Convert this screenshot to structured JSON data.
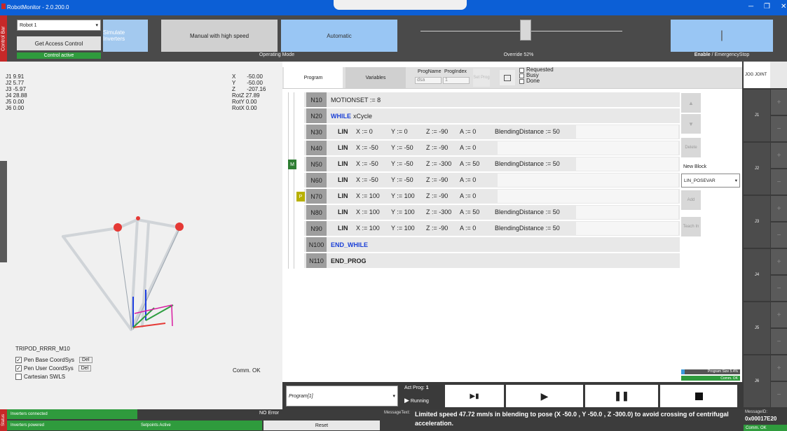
{
  "window": {
    "title": "RobotMonitor - 2.0.200.0",
    "minimize": "─",
    "restore": "❐",
    "close": "✕"
  },
  "control_bar": {
    "side_label": "Control Bar",
    "robot_select": "Robot 1",
    "get_access": "Get Access Control",
    "control_active": "Control active",
    "simulate_inverters": "Simulate Inverters",
    "manual_high_speed": "Manual with high speed",
    "automatic": "Automatic",
    "operating_mode_label": "Operating Mode",
    "override_label": "Override 52%",
    "override_percent": 52,
    "enable_label": "Enable",
    "estop_label": " / EmergencyStop",
    "enable_glyph": "|"
  },
  "joints": [
    "J1 9.91",
    "J2 5.77",
    "J3 -5.97",
    "J4 28.88",
    "J5 0.00",
    "J6 0.00"
  ],
  "cartesian": [
    {
      "axis": "X",
      "value": "-50.00"
    },
    {
      "axis": "Y",
      "value": "-50.00"
    },
    {
      "axis": "Z",
      "value": "-207.16"
    },
    {
      "axis": "RotZ",
      "value": "27.89"
    },
    {
      "axis": "RotY",
      "value": "0.00"
    },
    {
      "axis": "RotX",
      "value": "0.00"
    }
  ],
  "robot_name": "TRIPOD_RRRR_M10",
  "pen_base": "Pen Base CoordSys",
  "pen_user": "Pen User CoordSys",
  "cartesian_swls": "Cartesian SWLS",
  "del": "Del",
  "check": "✓",
  "comm_ok": "Comm. OK",
  "program_tabs": {
    "program": "Program",
    "variables": "Variables",
    "prog_name_label": "ProgName",
    "prog_index_label": "ProgIndex",
    "prog_name_value": "dsa",
    "prog_index_value": "1",
    "set_prog": "Set Prog",
    "requested": "Requested",
    "busy": "Busy",
    "done": "Done"
  },
  "program_lines": [
    {
      "n": "N10",
      "kind": "plain",
      "text": "MOTIONSET := 8"
    },
    {
      "n": "N20",
      "kind": "while",
      "kw": "WHILE",
      "text": "xCycle"
    },
    {
      "n": "N30",
      "kind": "lin",
      "x": "X := 0",
      "y": "Y := 0",
      "z": "Z := -90",
      "a": "A := 0",
      "b": "BlendingDistance := 50"
    },
    {
      "n": "N40",
      "kind": "lin",
      "x": "X := -50",
      "y": "Y := -50",
      "z": "Z := -90",
      "a": "A := 0",
      "b": ""
    },
    {
      "n": "N50",
      "kind": "lin",
      "x": "X := -50",
      "y": "Y := -50",
      "z": "Z := -300",
      "a": "A := 50",
      "b": "BlendingDistance := 50"
    },
    {
      "n": "N60",
      "kind": "lin",
      "x": "X := -50",
      "y": "Y := -50",
      "z": "Z := -90",
      "a": "A := 0",
      "b": ""
    },
    {
      "n": "N70",
      "kind": "lin",
      "x": "X := 100",
      "y": "Y := 100",
      "z": "Z := -90",
      "a": "A := 0",
      "b": ""
    },
    {
      "n": "N80",
      "kind": "lin",
      "x": "X := 100",
      "y": "Y := 100",
      "z": "Z := -300",
      "a": "A := 50",
      "b": "BlendingDistance := 50"
    },
    {
      "n": "N90",
      "kind": "lin",
      "x": "X := 100",
      "y": "Y := 100",
      "z": "Z := -90",
      "a": "A := 0",
      "b": "BlendingDistance := 50"
    },
    {
      "n": "N100",
      "kind": "endwhile",
      "kw": "END_WHILE",
      "text": ""
    },
    {
      "n": "N110",
      "kind": "endprog",
      "kw": "END_PROG",
      "text": ""
    }
  ],
  "lin_kw": "LIN",
  "markers": {
    "m": "M",
    "p": "P"
  },
  "side_buttons": {
    "up": "▲",
    "down": "▼",
    "delete": "Delete",
    "new_block": "New Block",
    "new_block_value": "LIN_POSEVAR",
    "add": "Add",
    "teach_in": "Teach In"
  },
  "program_size": "Program Size 5.4%",
  "program_size_percent": 5.4,
  "exec_bar": {
    "program_select": "Program[1]",
    "act_prog_label": "Act Prog:",
    "act_prog_value": "1",
    "running": "Running"
  },
  "jog": {
    "mode": "JOG JOINT",
    "joints": [
      "J1",
      "J2",
      "J3",
      "J4",
      "J5",
      "J6"
    ],
    "plus": "+",
    "minus": "−"
  },
  "status_bar": {
    "side_label": "Status",
    "inverters_connected": "Inverters connected",
    "inverters_powered": "Inverters powered",
    "setpoints_active": "Setpoints Active",
    "no_error": "NO Error",
    "reset": "Reset",
    "message_label": "MessageText:",
    "message": "Limited speed 47.72 mm/s in blending to pose (X -50.0 , Y -50.0 , Z -300.0) to avoid crossing of centrifugal acceleration.",
    "message_id_label": "MessageID:",
    "message_id": "0x00017E20",
    "comm_ok": "Comm. OK"
  },
  "colors": {
    "accent_blue": "#99c6f4",
    "status_green": "#2f9b3d",
    "red": "#c62828",
    "keyword_blue": "#1a3fd6"
  }
}
